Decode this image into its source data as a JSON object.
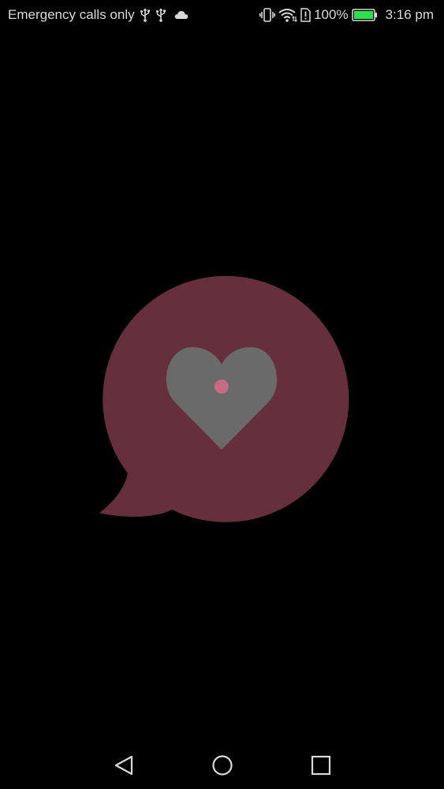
{
  "status_bar": {
    "carrier_text": "Emergency calls only",
    "left_icons": [
      "usb-icon",
      "usb-icon",
      "cloud-icon"
    ],
    "right_icons": [
      "vibrate-icon",
      "wifi-icon",
      "sim-alert-icon",
      "battery-icon"
    ],
    "battery_percent_text": "100%",
    "battery_level": 1.0,
    "time": "3:16 pm"
  },
  "splash": {
    "logo_icon": "chat-bubble-heart-icon",
    "colors": {
      "bubble": "#652f3e",
      "heart": "#6a6a6a",
      "dot": "#c76a86"
    }
  },
  "nav_bar": {
    "buttons": [
      "back-icon",
      "home-icon",
      "recents-icon"
    ]
  },
  "colors": {
    "background": "#000000",
    "status_text": "#d9d9d9",
    "battery_fill": "#2ee04a"
  }
}
